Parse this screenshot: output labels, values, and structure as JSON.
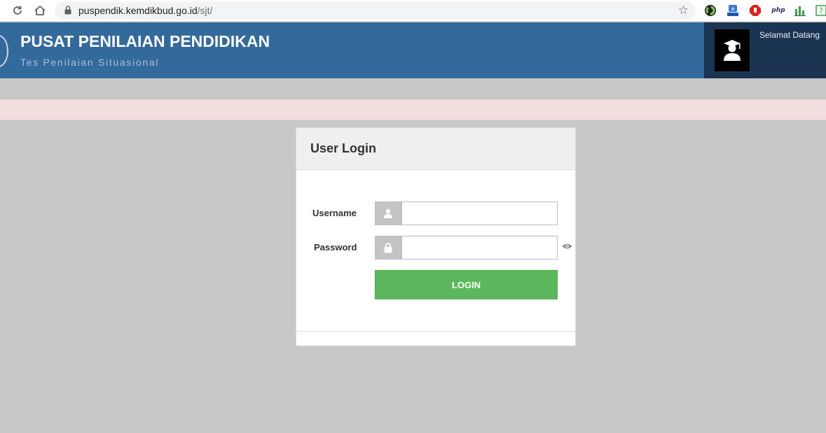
{
  "browser": {
    "url_host": "puspendik.kemdikbud.go.id",
    "url_path": "/sjt/"
  },
  "extensions": [
    "color-wheel-icon",
    "translate-icon",
    "adblock-icon",
    "php-icon",
    "chart-icon",
    "help-icon"
  ],
  "header": {
    "title": "PUSAT PENILAIAN PENDIDIKAN",
    "subtitle": "Tes Penilaian Situasional",
    "welcome": "Selamat Datang",
    "background_color": "#336a9b",
    "user_panel_color": "#1b3451"
  },
  "alert": {
    "background_color": "#f2dede"
  },
  "login": {
    "title": "User Login",
    "username_label": "Username",
    "username_value": "",
    "password_label": "Password",
    "password_value": "",
    "button_label": "LOGIN",
    "button_color": "#5cb85c"
  }
}
